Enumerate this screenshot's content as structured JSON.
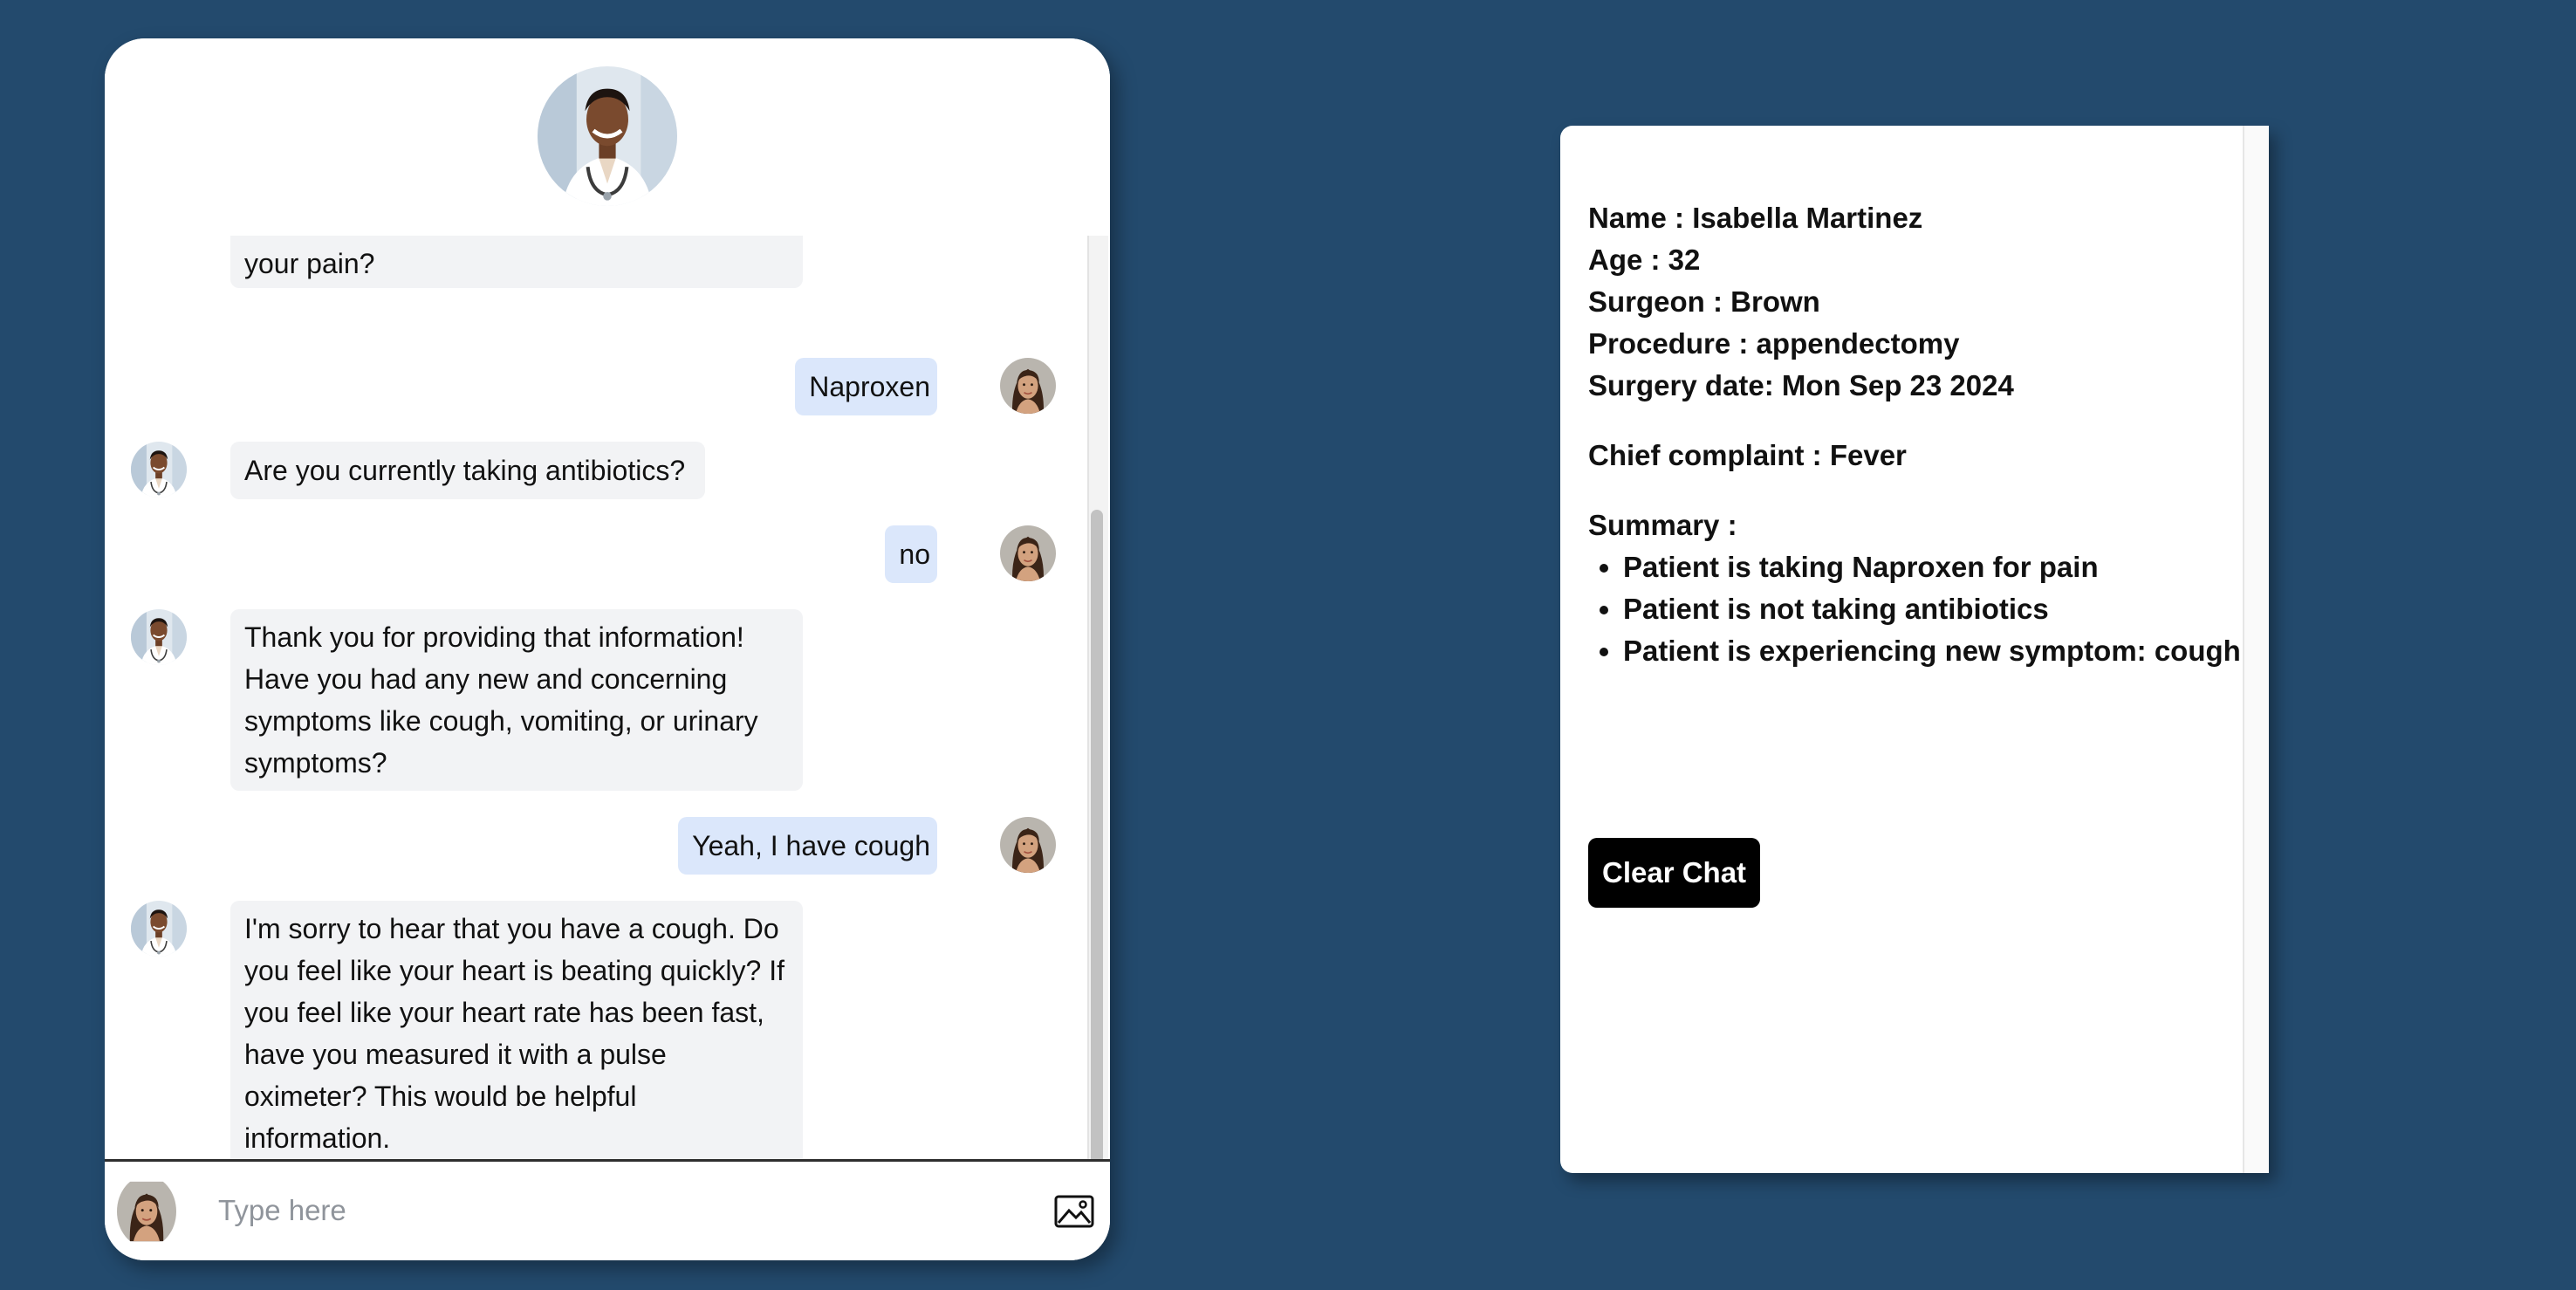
{
  "chat": {
    "messages": [
      {
        "sender": "bot",
        "text": "your pain?"
      },
      {
        "sender": "user",
        "text": "Naproxen"
      },
      {
        "sender": "bot",
        "text": "Are you currently taking antibiotics?"
      },
      {
        "sender": "user",
        "text": "no"
      },
      {
        "sender": "bot",
        "text": "Thank you for providing that information! Have you had any new and concerning symptoms like cough, vomiting, or urinary symptoms?"
      },
      {
        "sender": "user",
        "text": "Yeah, I have cough"
      },
      {
        "sender": "bot",
        "text": "I'm sorry to hear that you have a cough. Do you feel like your heart is beating quickly? If you feel like your heart rate has been fast, have you measured it with a pulse oximeter? This would be helpful information."
      }
    ],
    "input_placeholder": "Type here"
  },
  "patient": {
    "name": "Name : Isabella Martinez",
    "age": "Age : 32",
    "surgeon": "Surgeon : Brown",
    "procedure": "Procedure : appendectomy",
    "surgery_date": "Surgery date: Mon Sep 23 2024",
    "chief_complaint": "Chief complaint : Fever",
    "summary_label": "Summary :",
    "summary": [
      "Patient is taking Naproxen for pain",
      "Patient is not taking antibiotics",
      "Patient is experiencing new symptom: cough"
    ]
  },
  "actions": {
    "clear_label": "Clear Chat"
  },
  "colors": {
    "background": "#234a6d",
    "bot_bubble": "#f2f3f5",
    "user_bubble": "#dbe7fb",
    "button": "#000000"
  }
}
